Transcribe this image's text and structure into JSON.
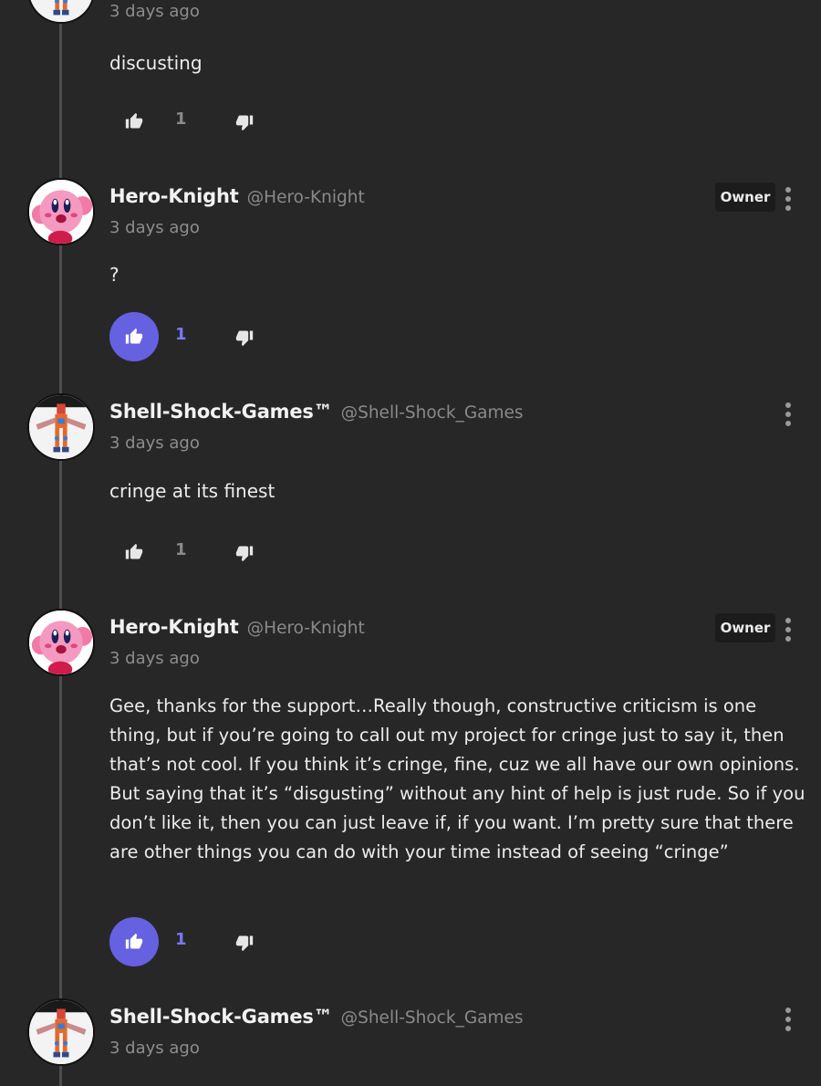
{
  "comments": [
    {
      "username": "",
      "handle": "",
      "time": "3 days ago",
      "text": "discusting",
      "owner": false,
      "likes": "1",
      "liked": false
    },
    {
      "username": "Hero-Knight",
      "handle": "@Hero-Knight",
      "time": "3 days ago",
      "text": "?",
      "owner": true,
      "owner_label": "Owner",
      "likes": "1",
      "liked": true
    },
    {
      "username": "Shell-Shock-Games™",
      "handle": "@Shell-Shock_Games",
      "time": "3 days ago",
      "text": "cringe at its finest",
      "owner": false,
      "likes": "1",
      "liked": false
    },
    {
      "username": "Hero-Knight",
      "handle": "@Hero-Knight",
      "time": "3 days ago",
      "text": "Gee, thanks for the support…Really though, constructive criticism is one thing, but if you’re going to call out my project for cringe just to say it, then that’s not cool. If you think it’s cringe, fine, cuz we all have our own opinions. But saying that it’s “disgusting” without any hint of help is just rude. So if you don’t like it, then you can just leave if, if you want. I’m pretty sure that there are other things you can do with your time instead of seeing “cringe”",
      "owner": true,
      "owner_label": "Owner",
      "likes": "1",
      "liked": true
    },
    {
      "username": "Shell-Shock-Games™",
      "handle": "@Shell-Shock_Games",
      "time": "3 days ago",
      "text": "",
      "owner": false,
      "likes": "",
      "liked": false
    }
  ],
  "icons": {
    "like": "thumbs-up-icon",
    "dislike": "thumbs-down-icon",
    "menu": "more-vertical-icon"
  },
  "colors": {
    "background": "#272727",
    "accent": "#6561e0",
    "muted_text": "#8d8d8d"
  }
}
